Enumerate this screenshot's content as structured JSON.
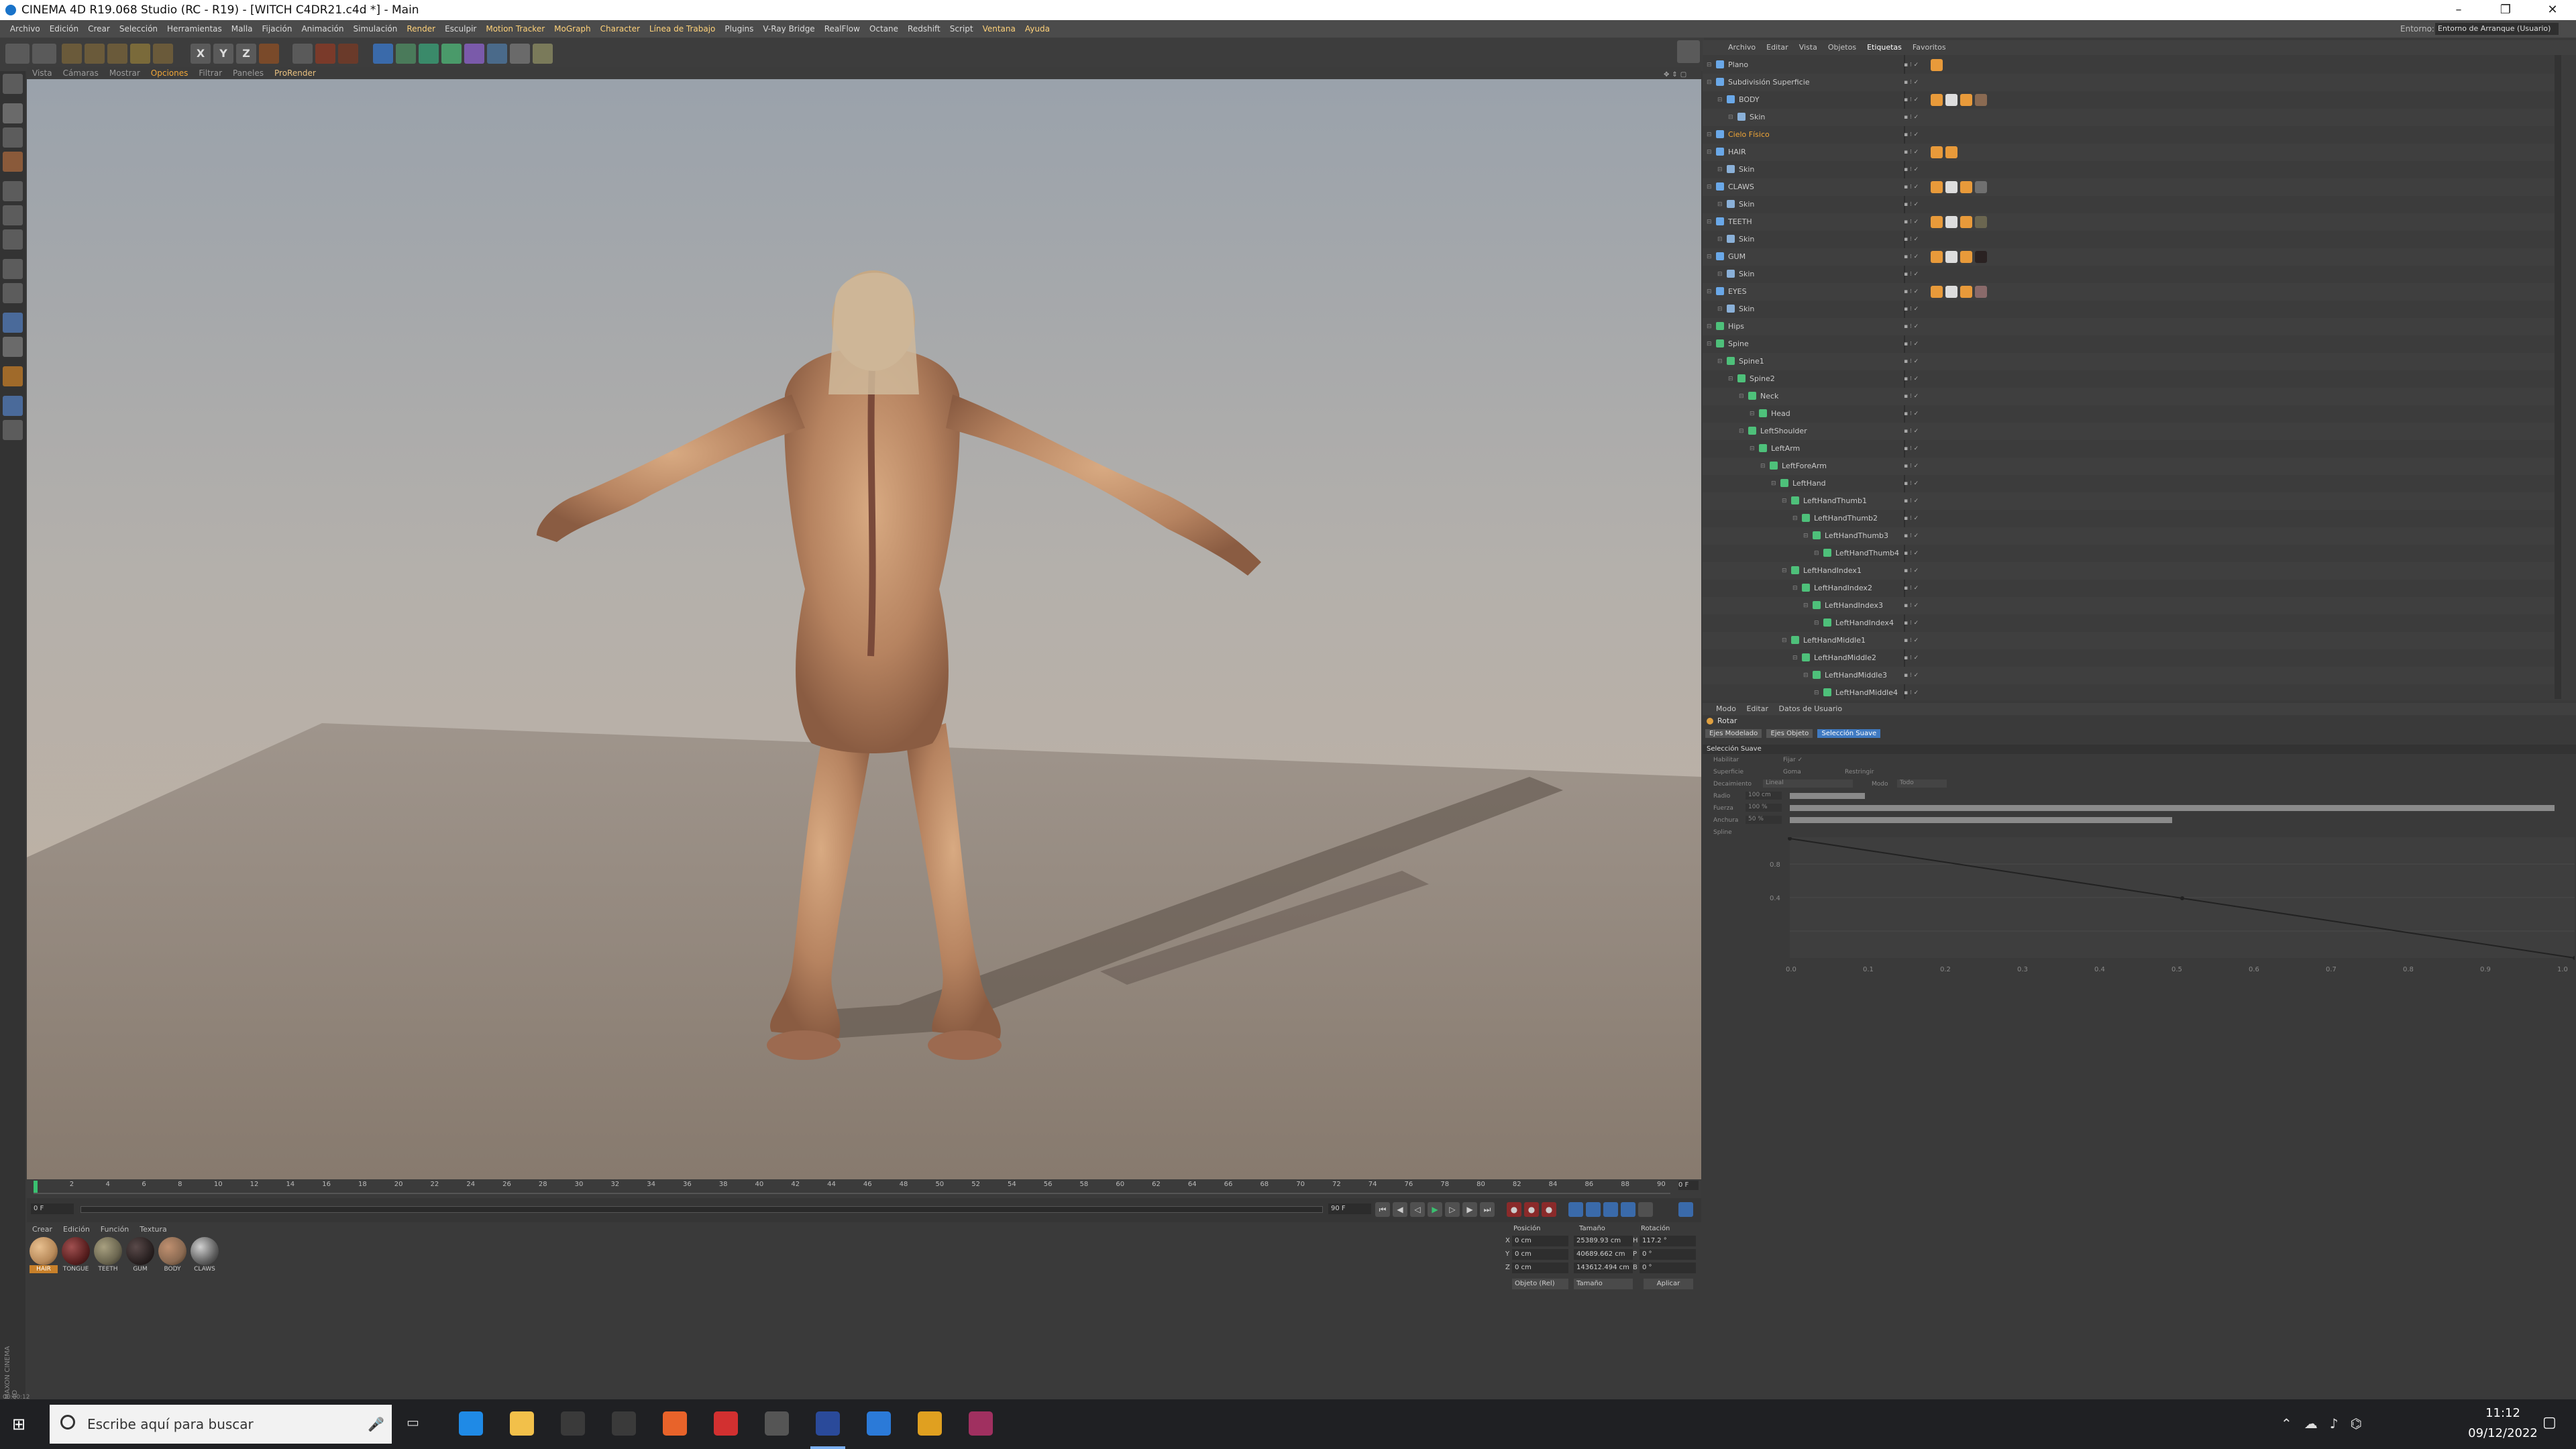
{
  "window": {
    "title": "CINEMA 4D R19.068 Studio (RC - R19) - [WITCH C4DR21.c4d *] - Main",
    "controls": [
      "–",
      "❐",
      "✕"
    ]
  },
  "menubar": {
    "items": [
      "Archivo",
      "Edición",
      "Crear",
      "Selección",
      "Herramientas",
      "Malla",
      "Fijación",
      "Animación",
      "Simulación",
      "Render",
      "Esculpir",
      "Motion Tracker",
      "MoGraph",
      "Character",
      "Línea de Trabajo",
      "Plugins",
      "V-Ray Bridge",
      "RealFlow",
      "Octane",
      "Redshift",
      "Script",
      "Ventana",
      "Ayuda"
    ],
    "layout_label": "Entorno:",
    "layout_value": "Entorno de Arranque (Usuario)"
  },
  "toolbar": {
    "axis_labels": [
      "X",
      "Y",
      "Z"
    ]
  },
  "viewport": {
    "menu": [
      "Vista",
      "Cámaras",
      "Mostrar",
      "Opciones",
      "Filtrar",
      "Paneles",
      "ProRender"
    ],
    "active_menu": "Opciones"
  },
  "timeline": {
    "ticks": [
      "0",
      "2",
      "4",
      "6",
      "8",
      "10",
      "12",
      "14",
      "16",
      "18",
      "20",
      "22",
      "24",
      "26",
      "28",
      "30",
      "32",
      "34",
      "36",
      "38",
      "40",
      "42",
      "44",
      "46",
      "48",
      "50",
      "52",
      "54",
      "56",
      "58",
      "60",
      "62",
      "64",
      "66",
      "68",
      "70",
      "72",
      "74",
      "76",
      "78",
      "80",
      "82",
      "84",
      "86",
      "88",
      "90"
    ],
    "current_frame": "0 F",
    "start_frame": "0 F",
    "end_frame": "90 F",
    "end_frame_right": "90 F"
  },
  "material_manager": {
    "menu": [
      "Crear",
      "Edición",
      "Función",
      "Textura"
    ],
    "materials": [
      {
        "name": "HAIR",
        "color": "#b88a5a"
      },
      {
        "name": "TONGUE",
        "color": "#5a2020"
      },
      {
        "name": "TEETH",
        "color": "#6b6650"
      },
      {
        "name": "GUM",
        "color": "#2a2222"
      },
      {
        "name": "BODY",
        "color": "#8a6a52"
      },
      {
        "name": "CLAWS",
        "color": "#606060"
      }
    ]
  },
  "coordinates": {
    "headers": [
      "Posición",
      "Tamaño",
      "Rotación"
    ],
    "rows": [
      {
        "axis": "X",
        "pos": "0 cm",
        "size": "25389.93 cm",
        "rot_axis": "H",
        "rot": "117.2 °"
      },
      {
        "axis": "Y",
        "pos": "0 cm",
        "size": "40689.662 cm",
        "rot_axis": "P",
        "rot": "0 °"
      },
      {
        "axis": "Z",
        "pos": "0 cm",
        "size": "143612.494 cm",
        "rot_axis": "B",
        "rot": "0 °"
      }
    ],
    "mode_left": "Objeto (Rel)",
    "mode_right": "Tamaño",
    "apply": "Aplicar"
  },
  "object_manager": {
    "menu": [
      "Archivo",
      "Editar",
      "Vista",
      "Objetos",
      "Etiquetas",
      "Favoritos"
    ],
    "active_menu": "Etiquetas",
    "objects": [
      {
        "name": "Plano",
        "indent": 0,
        "color": "#6aa8e8",
        "tags": [
          "#e89a3a"
        ]
      },
      {
        "name": "Subdivisión Superficie",
        "indent": 0,
        "color": "#6aa8e8",
        "tags": []
      },
      {
        "name": "BODY",
        "indent": 1,
        "color": "#6aa8e8",
        "tags": [
          "#e89a3a",
          "#dddddd",
          "#e89a3a",
          "#8a6a52"
        ]
      },
      {
        "name": "Skin",
        "indent": 2,
        "color": "#8ab0d8",
        "tags": []
      },
      {
        "name": "Cielo Físico",
        "indent": 0,
        "color": "#6aa8e8",
        "tags": [],
        "highlight": true
      },
      {
        "name": "HAIR",
        "indent": 0,
        "color": "#6aa8e8",
        "tags": [
          "#e89a3a",
          "#e89a3a"
        ]
      },
      {
        "name": "Skin",
        "indent": 1,
        "color": "#8ab0d8",
        "tags": []
      },
      {
        "name": "CLAWS",
        "indent": 0,
        "color": "#6aa8e8",
        "tags": [
          "#e89a3a",
          "#dddddd",
          "#e89a3a",
          "#707070"
        ]
      },
      {
        "name": "Skin",
        "indent": 1,
        "color": "#8ab0d8",
        "tags": []
      },
      {
        "name": "TEETH",
        "indent": 0,
        "color": "#6aa8e8",
        "tags": [
          "#e89a3a",
          "#dddddd",
          "#e89a3a",
          "#6b6650"
        ]
      },
      {
        "name": "Skin",
        "indent": 1,
        "color": "#8ab0d8",
        "tags": []
      },
      {
        "name": "GUM",
        "indent": 0,
        "color": "#6aa8e8",
        "tags": [
          "#e89a3a",
          "#dddddd",
          "#e89a3a",
          "#2a2222"
        ]
      },
      {
        "name": "Skin",
        "indent": 1,
        "color": "#8ab0d8",
        "tags": []
      },
      {
        "name": "EYES",
        "indent": 0,
        "color": "#6aa8e8",
        "tags": [
          "#e89a3a",
          "#dddddd",
          "#e89a3a",
          "#8a6a6a"
        ]
      },
      {
        "name": "Skin",
        "indent": 1,
        "color": "#8ab0d8",
        "tags": []
      },
      {
        "name": "Hips",
        "indent": 0,
        "color": "#4ec07a",
        "tags": []
      },
      {
        "name": "Spine",
        "indent": 0,
        "color": "#4ec07a",
        "tags": []
      },
      {
        "name": "Spine1",
        "indent": 1,
        "color": "#4ec07a",
        "tags": []
      },
      {
        "name": "Spine2",
        "indent": 2,
        "color": "#4ec07a",
        "tags": []
      },
      {
        "name": "Neck",
        "indent": 3,
        "color": "#4ec07a",
        "tags": []
      },
      {
        "name": "Head",
        "indent": 4,
        "color": "#4ec07a",
        "tags": []
      },
      {
        "name": "LeftShoulder",
        "indent": 3,
        "color": "#4ec07a",
        "tags": []
      },
      {
        "name": "LeftArm",
        "indent": 4,
        "color": "#4ec07a",
        "tags": []
      },
      {
        "name": "LeftForeArm",
        "indent": 5,
        "color": "#4ec07a",
        "tags": []
      },
      {
        "name": "LeftHand",
        "indent": 6,
        "color": "#4ec07a",
        "tags": []
      },
      {
        "name": "LeftHandThumb1",
        "indent": 7,
        "color": "#4ec07a",
        "tags": []
      },
      {
        "name": "LeftHandThumb2",
        "indent": 8,
        "color": "#4ec07a",
        "tags": []
      },
      {
        "name": "LeftHandThumb3",
        "indent": 9,
        "color": "#4ec07a",
        "tags": []
      },
      {
        "name": "LeftHandThumb4",
        "indent": 10,
        "color": "#4ec07a",
        "tags": []
      },
      {
        "name": "LeftHandIndex1",
        "indent": 7,
        "color": "#4ec07a",
        "tags": []
      },
      {
        "name": "LeftHandIndex2",
        "indent": 8,
        "color": "#4ec07a",
        "tags": []
      },
      {
        "name": "LeftHandIndex3",
        "indent": 9,
        "color": "#4ec07a",
        "tags": []
      },
      {
        "name": "LeftHandIndex4",
        "indent": 10,
        "color": "#4ec07a",
        "tags": []
      },
      {
        "name": "LeftHandMiddle1",
        "indent": 7,
        "color": "#4ec07a",
        "tags": []
      },
      {
        "name": "LeftHandMiddle2",
        "indent": 8,
        "color": "#4ec07a",
        "tags": []
      },
      {
        "name": "LeftHandMiddle3",
        "indent": 9,
        "color": "#4ec07a",
        "tags": []
      },
      {
        "name": "LeftHandMiddle4",
        "indent": 10,
        "color": "#4ec07a",
        "tags": []
      }
    ]
  },
  "attribute_manager": {
    "menu": [
      "Modo",
      "Editar",
      "Datos de Usuario"
    ],
    "tool_name": "Rotar",
    "tabs": [
      "Ejes Modelado",
      "Ejes Objeto",
      "Selección Suave"
    ],
    "active_tab": "Selección Suave",
    "section": "Selección Suave",
    "fields": {
      "habilitar": "Habilitar",
      "fijar": "Fijar ✓",
      "superficie": "Superficie",
      "goma": "Goma",
      "restringir": "Restringir",
      "decaimiento_label": "Decaimiento",
      "decaimiento_value": "Lineal",
      "modo_label": "Modo",
      "modo_value": "Todo",
      "radio_label": "Radio",
      "radio_value": "100 cm",
      "fuerza_label": "Fuerza",
      "fuerza_value": "100 %",
      "anchura_label": "Anchura",
      "anchura_value": "50 %",
      "spline_label": "Spline"
    },
    "graph": {
      "y_ticks": [
        "0.8",
        "0.4"
      ],
      "x_ticks": [
        "0.0",
        "0.1",
        "0.2",
        "0.3",
        "0.4",
        "0.5",
        "0.6",
        "0.7",
        "0.8",
        "0.9",
        "1.0"
      ]
    }
  },
  "taskbar": {
    "search_placeholder": "Escribe aquí para buscar",
    "time": "11:12",
    "date": "09/12/2022",
    "apps": [
      {
        "name": "edge",
        "color": "#1f8ae6"
      },
      {
        "name": "explorer",
        "color": "#f2c04a"
      },
      {
        "name": "store",
        "color": "#3a3a3a"
      },
      {
        "name": "mail",
        "color": "#3a3a3a"
      },
      {
        "name": "firefox",
        "color": "#e8632a"
      },
      {
        "name": "davinci",
        "color": "#d23030"
      },
      {
        "name": "kdenlive",
        "color": "#555555"
      },
      {
        "name": "cinema4d",
        "color": "#2a4a9a"
      },
      {
        "name": "wordpad",
        "color": "#2b7ad8"
      },
      {
        "name": "chrome",
        "color": "#e0a020"
      },
      {
        "name": "winrar",
        "color": "#a03060"
      }
    ]
  },
  "brand": "MAXON CINEMA 4D",
  "status": "00:00:12"
}
